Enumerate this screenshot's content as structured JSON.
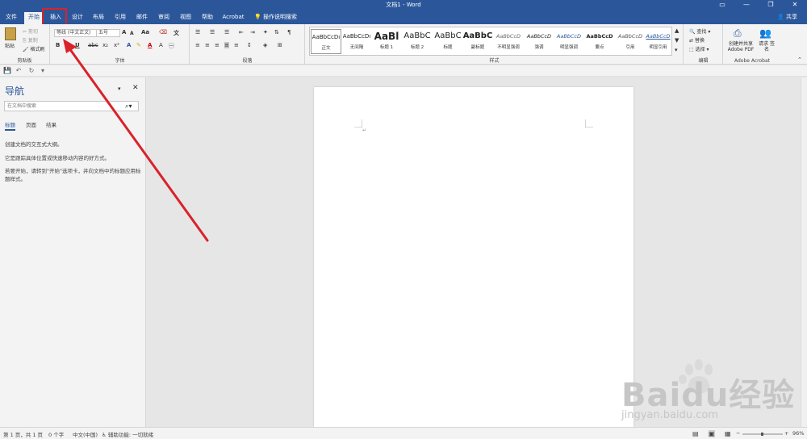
{
  "window": {
    "title": "文档1 - Word",
    "minimize": "—",
    "restore": "❐",
    "close": "✕"
  },
  "tabs": [
    {
      "label": "文件",
      "active": false
    },
    {
      "label": "开始",
      "active": true
    },
    {
      "label": "插入",
      "active": false
    },
    {
      "label": "设计",
      "active": false
    },
    {
      "label": "布局",
      "active": false
    },
    {
      "label": "引用",
      "active": false
    },
    {
      "label": "邮件",
      "active": false
    },
    {
      "label": "审阅",
      "active": false
    },
    {
      "label": "视图",
      "active": false
    },
    {
      "label": "帮助",
      "active": false
    },
    {
      "label": "Acrobat",
      "active": false
    }
  ],
  "tell_me": "操作说明搜索",
  "share_label": "共享",
  "ribbon": {
    "clipboard": {
      "label": "剪贴板",
      "paste": "粘贴",
      "cut": "剪切",
      "copy": "复制",
      "format_painter": "格式刷"
    },
    "font": {
      "label": "字体",
      "font_name": "等线 (中文正文)",
      "font_size": "五号",
      "bold": "B",
      "italic": "I",
      "underline": "U",
      "strike": "abc",
      "sub": "x₂",
      "sup": "x²",
      "case": "Aa",
      "grow": "A",
      "shrink": "A",
      "color_a": "A"
    },
    "paragraph": {
      "label": "段落"
    },
    "styles": {
      "label": "样式",
      "items": [
        {
          "preview": "AaBbCcDı",
          "name": "正文"
        },
        {
          "preview": "AaBbCcDı",
          "name": "无间隔"
        },
        {
          "preview": "AaBl",
          "name": "标题 1"
        },
        {
          "preview": "AaBbC",
          "name": "标题 2"
        },
        {
          "preview": "AaBbC",
          "name": "标题"
        },
        {
          "preview": "AaBbC",
          "name": "副标题"
        },
        {
          "preview": "AaBbCcD",
          "name": "不明显强调"
        },
        {
          "preview": "AaBbCcD",
          "name": "强调"
        },
        {
          "preview": "AaBbCcD",
          "name": "明显强调"
        },
        {
          "preview": "AaBbCcD",
          "name": "要点"
        },
        {
          "preview": "AaBbCcD",
          "name": "引用"
        },
        {
          "preview": "AaBbCcD",
          "name": "明显引用"
        }
      ]
    },
    "editing": {
      "label": "编辑",
      "find": "查找",
      "replace": "替换",
      "select": "选择"
    },
    "acrobat": {
      "label": "Adobe Acrobat",
      "create_share": "创建并共享 Adobe PDF",
      "request_sign": "请求 签名"
    }
  },
  "nav": {
    "title": "导航",
    "search_placeholder": "在文档中搜索",
    "tabs": [
      "标题",
      "页面",
      "结果"
    ],
    "text1": "创建文档的交互式大纲。",
    "text2": "它是跟踪具体位置或快速移动内容的好方式。",
    "text3": "若要开始，请转到\"开始\"选项卡，并向文档中的标题应用标题样式。"
  },
  "status": {
    "page": "第 1 页，共 1 页",
    "words": "0 个字",
    "lang": "中文(中国)",
    "accessibility": "辅助功能: 一切就绪",
    "zoom": "96%"
  },
  "watermark": {
    "text": "Baidu经验",
    "sub": "jingyan.baidu.com"
  },
  "colors": {
    "accent": "#2b579a",
    "highlight": "#d9222a"
  }
}
